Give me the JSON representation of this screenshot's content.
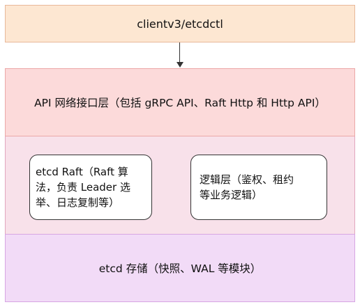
{
  "client_box": {
    "label": "clientv3/etcdctl"
  },
  "api_layer": {
    "label": "API 网络接口层（包括 gRPC API、Raft Http 和 Http API）"
  },
  "raft_box": {
    "lines": [
      "etcd Raft（Raft 算",
      "法，负责 Leader 选",
      "举、日志复制等）"
    ]
  },
  "logic_box": {
    "lines": [
      "逻辑层（鉴权、租约",
      "等业务逻辑）"
    ]
  },
  "storage_layer": {
    "label": "etcd 存储（快照、WAL 等模块）"
  },
  "colors": {
    "client_fill": "#fde7d2",
    "api_fill": "#fcdada",
    "middle_fill": "#f8e1ea",
    "storage_fill": "#f2dbf7"
  }
}
